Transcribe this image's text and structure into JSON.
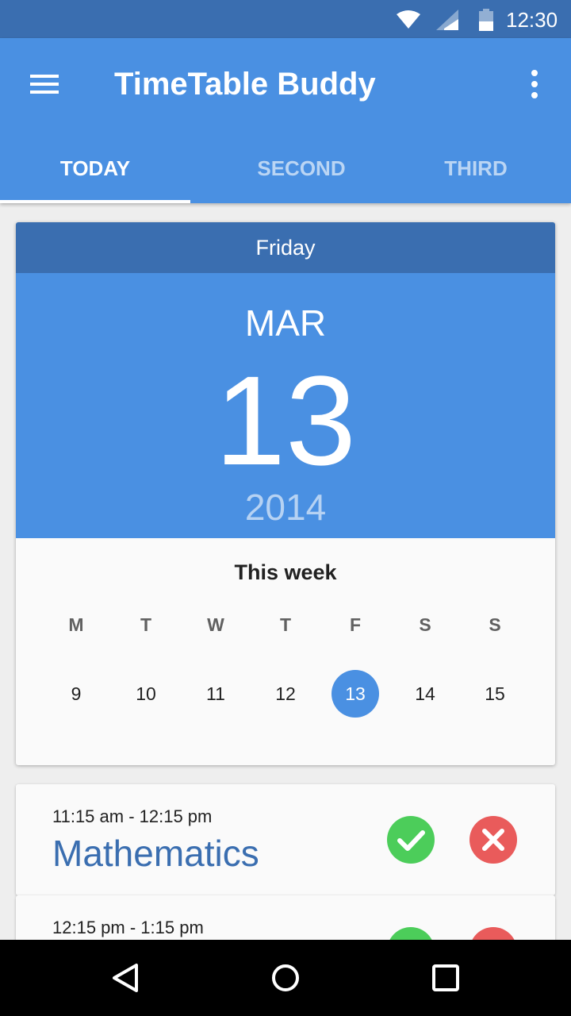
{
  "status_bar": {
    "time": "12:30",
    "icons": [
      "wifi-icon",
      "cell-signal-icon",
      "battery-icon"
    ]
  },
  "app_bar": {
    "title": "TimeTable Buddy",
    "menu_icon": "hamburger-menu-icon",
    "overflow_icon": "more-vert-icon",
    "accent_color": "#4a90e2",
    "dark_color": "#3a6eb0"
  },
  "tabs": [
    {
      "label": "TODAY",
      "selected": true
    },
    {
      "label": "SECOND",
      "selected": false
    },
    {
      "label": "THIRD",
      "selected": false
    }
  ],
  "date_card": {
    "day_name": "Friday",
    "month": "MAR",
    "day": "13",
    "year": "2014",
    "week_title": "This week",
    "weekdays": [
      "M",
      "T",
      "W",
      "T",
      "F",
      "S",
      "S"
    ],
    "dates": [
      "9",
      "10",
      "11",
      "12",
      "13",
      "14",
      "15"
    ],
    "selected_date": "13"
  },
  "classes": [
    {
      "time": "11:15 am - 12:15 pm",
      "subject": "Mathematics"
    },
    {
      "time": "12:15 pm - 1:15 pm",
      "subject": ""
    }
  ],
  "action_colors": {
    "check": "#4ccd5a",
    "close": "#e95b5b"
  },
  "nav_bar": {
    "icons": [
      "back-icon",
      "home-icon",
      "recents-icon"
    ]
  }
}
